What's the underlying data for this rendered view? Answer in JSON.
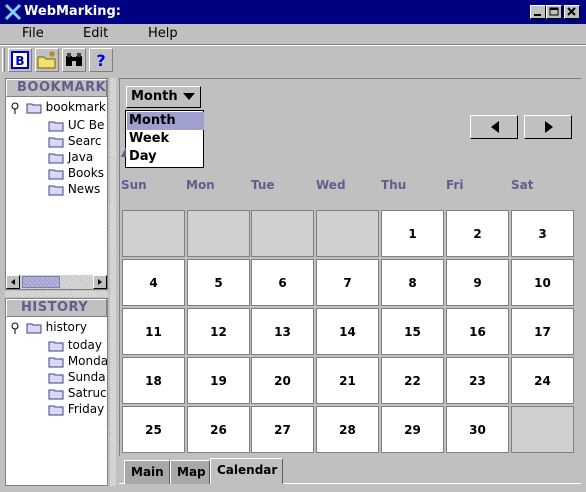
{
  "window": {
    "title": "WebMarking:"
  },
  "menu": {
    "items": [
      "File",
      "Edit",
      "Help"
    ]
  },
  "toolbar": {
    "buttons": [
      {
        "label": "B",
        "icon": "bookmark-icon"
      },
      {
        "icon": "new-folder-icon"
      },
      {
        "icon": "binoculars-icon"
      },
      {
        "label": "?",
        "icon": "help-icon"
      }
    ]
  },
  "bookmark_panel": {
    "header": "BOOKMARK",
    "root": "bookmark",
    "items": [
      "UC Be",
      "Searc",
      "Java",
      "Books",
      "News"
    ]
  },
  "history_panel": {
    "header": "HISTORY",
    "root": "history",
    "items": [
      "today",
      "Monda",
      "Sunda",
      "Satruc",
      "Friday"
    ]
  },
  "calendar": {
    "view_select": {
      "value": "Month",
      "options": [
        "Month",
        "Week",
        "Day"
      ],
      "highlighted": "Month"
    },
    "weekdays": [
      "Sun",
      "Mon",
      "Tue",
      "Wed",
      "Thu",
      "Fri",
      "Sat"
    ],
    "weeks": [
      [
        "",
        "",
        "",
        "",
        "1",
        "2",
        "3"
      ],
      [
        "4",
        "5",
        "6",
        "7",
        "8",
        "9",
        "10"
      ],
      [
        "11",
        "12",
        "13",
        "14",
        "15",
        "16",
        "17"
      ],
      [
        "18",
        "19",
        "20",
        "21",
        "22",
        "23",
        "24"
      ],
      [
        "25",
        "26",
        "27",
        "28",
        "29",
        "30",
        ""
      ]
    ]
  },
  "tabs": [
    {
      "label": "Main",
      "active": false
    },
    {
      "label": "Map",
      "active": false
    },
    {
      "label": "Calendar",
      "active": true
    }
  ],
  "colors": {
    "titlebar": "#000080",
    "header_text": "#5f5f8f",
    "selected_option": "#a0a0d0"
  }
}
